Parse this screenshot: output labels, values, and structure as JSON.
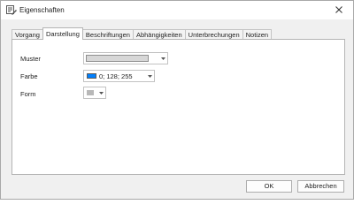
{
  "window": {
    "title": "Eigenschaften",
    "icon": "properties-icon",
    "close_icon": "close-icon"
  },
  "tabs": [
    {
      "label": "Vorgang",
      "active": false
    },
    {
      "label": "Darstellung",
      "active": true
    },
    {
      "label": "Beschriftungen",
      "active": false
    },
    {
      "label": "Abhängigkeiten",
      "active": false
    },
    {
      "label": "Unterbrechungen",
      "active": false
    },
    {
      "label": "Notizen",
      "active": false
    }
  ],
  "fields": {
    "muster": {
      "label": "Muster"
    },
    "farbe": {
      "label": "Farbe",
      "value": "0; 128; 255",
      "color": "#0080ff"
    },
    "form": {
      "label": "Form"
    }
  },
  "buttons": {
    "ok": "OK",
    "cancel": "Abbrechen"
  }
}
